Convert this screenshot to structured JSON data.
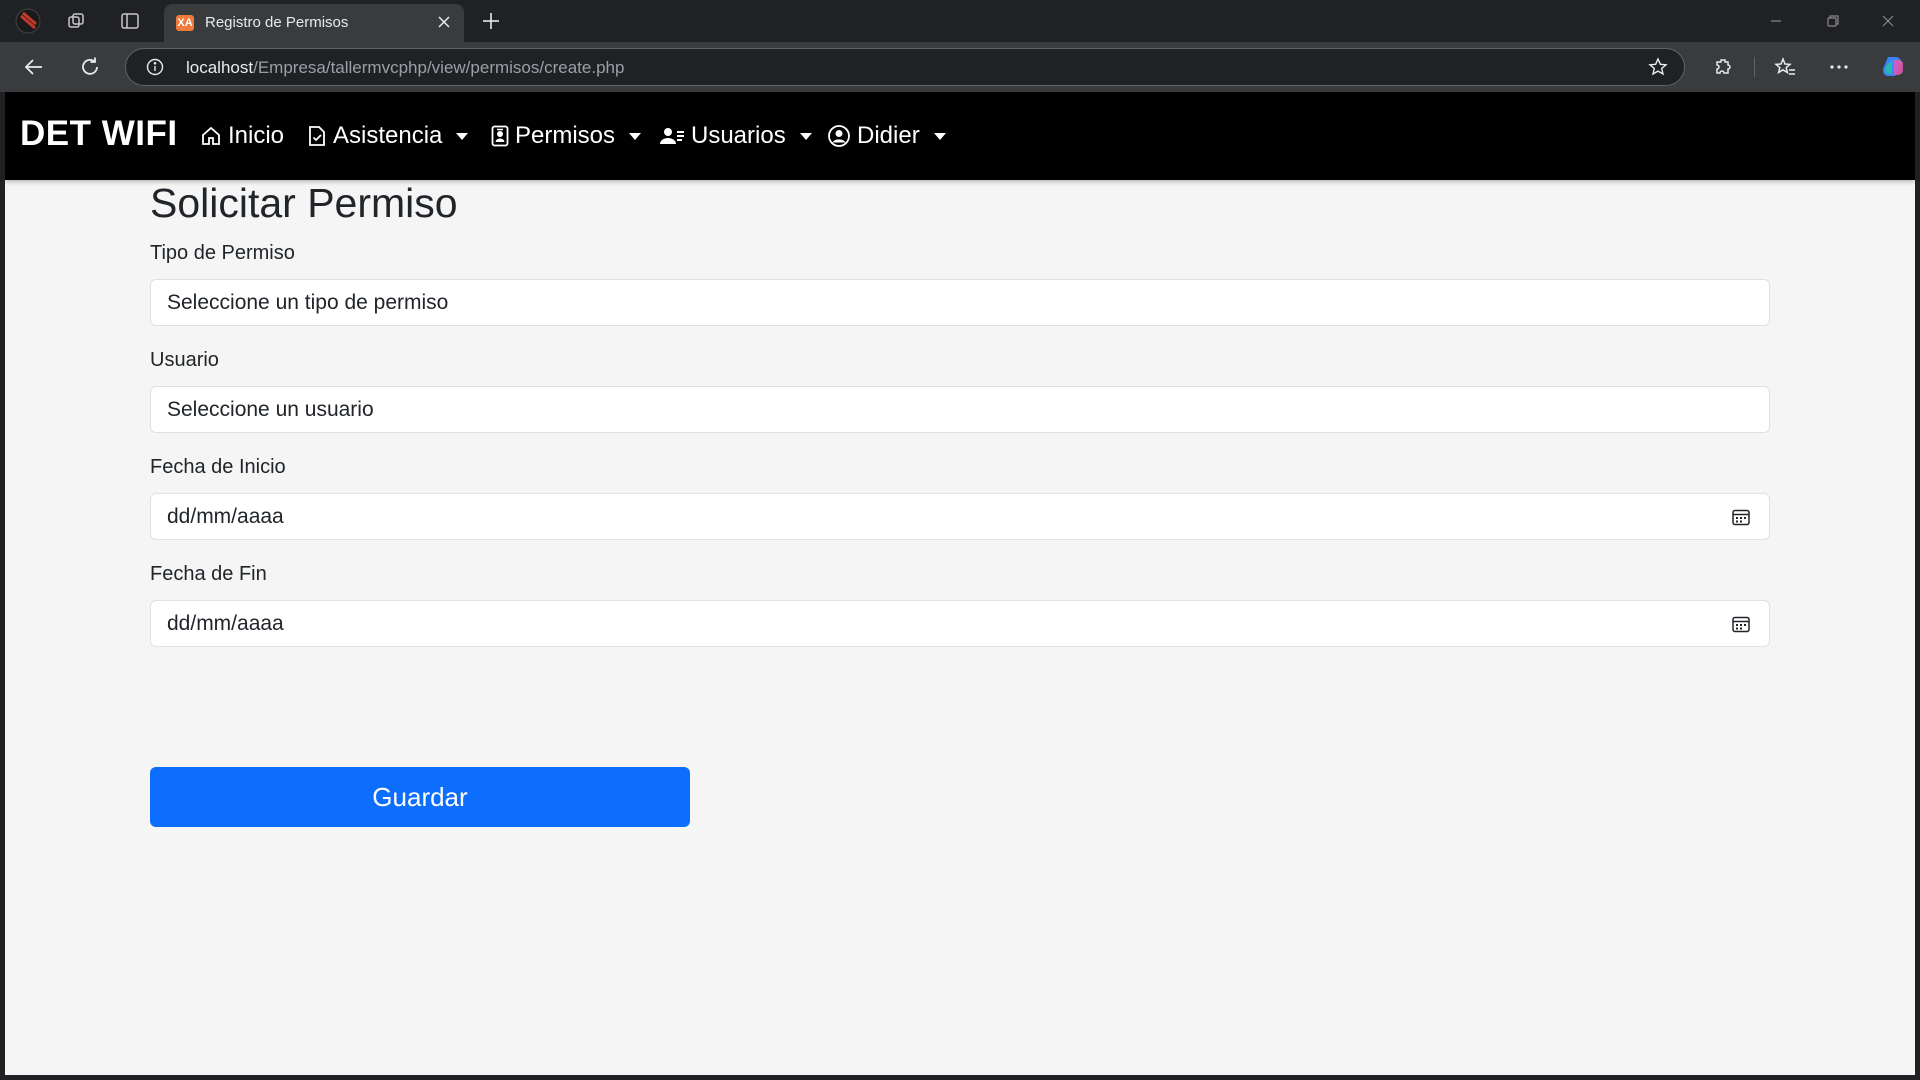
{
  "browser": {
    "tab_title": "Registro de Permisos",
    "url_host": "localhost",
    "url_path": "/Empresa/tallermvcphp/view/permisos/create.php",
    "tab_favicon_text": "XA"
  },
  "navbar": {
    "brand": "DET WIFI",
    "items": [
      {
        "label": "Inicio",
        "icon": "house-icon",
        "dropdown": false
      },
      {
        "label": "Asistencia",
        "icon": "file-check-icon",
        "dropdown": true
      },
      {
        "label": "Permisos",
        "icon": "person-badge-icon",
        "dropdown": true
      },
      {
        "label": "Usuarios",
        "icon": "people-icon",
        "dropdown": true
      },
      {
        "label": "Didier",
        "icon": "user-circle-icon",
        "dropdown": true
      }
    ]
  },
  "form": {
    "title": "Solicitar Permiso",
    "fields": [
      {
        "label": "Tipo de Permiso",
        "value": "Seleccione un tipo de permiso",
        "type": "select"
      },
      {
        "label": "Usuario",
        "value": "Seleccione un usuario",
        "type": "select"
      },
      {
        "label": "Fecha de Inicio",
        "value": "dd/mm/aaaa",
        "type": "date"
      },
      {
        "label": "Fecha de Fin",
        "value": "dd/mm/aaaa",
        "type": "date"
      }
    ],
    "submit_label": "Guardar"
  },
  "colors": {
    "navbar_bg": "#000000",
    "page_bg": "#f4f5f4",
    "primary_button": "#0d6efd",
    "browser_dark": "#202124"
  }
}
